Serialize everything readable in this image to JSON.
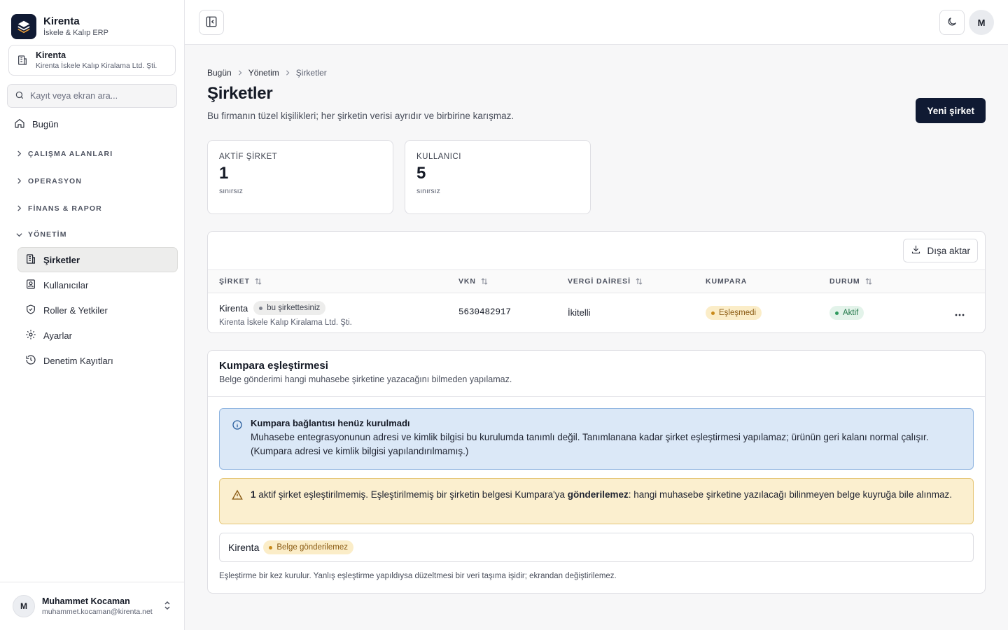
{
  "brand": {
    "name": "Kirenta",
    "subtitle": "İskele & Kalıp ERP"
  },
  "org": {
    "name": "Kirenta",
    "legal_name": "Kirenta İskele Kalıp Kiralama Ltd. Şti."
  },
  "search": {
    "placeholder": "Kayıt veya ekran ara..."
  },
  "nav": {
    "home": "Bugün",
    "groups": [
      {
        "label": "ÇALIŞMA ALANLARI"
      },
      {
        "label": "OPERASYON"
      },
      {
        "label": "FİNANS & RAPOR"
      },
      {
        "label": "YÖNETİM"
      }
    ],
    "items": [
      {
        "label": "Şirketler",
        "icon": "building-icon"
      },
      {
        "label": "Kullanıcılar",
        "icon": "user-badge-icon"
      },
      {
        "label": "Roller & Yetkiler",
        "icon": "shield-check-icon"
      },
      {
        "label": "Ayarlar",
        "icon": "gear-icon"
      },
      {
        "label": "Denetim Kayıtları",
        "icon": "history-icon"
      }
    ]
  },
  "user": {
    "initial": "M",
    "name": "Muhammet Kocaman",
    "email": "muhammet.kocaman@kirenta.net"
  },
  "topbar": {
    "avatar_initial": "M"
  },
  "breadcrumb": {
    "items": [
      "Bugün",
      "Yönetim",
      "Şirketler"
    ]
  },
  "page": {
    "title": "Şirketler",
    "description": "Bu firmanın tüzel kişilikleri; her şirketin verisi ayrıdır ve birbirine karışmaz.",
    "new_button": "Yeni şirket"
  },
  "stats": [
    {
      "label": "AKTİF ŞİRKET",
      "value": "1",
      "hint": "sınırsız"
    },
    {
      "label": "KULLANICI",
      "value": "5",
      "hint": "sınırsız"
    }
  ],
  "table": {
    "export_label": "Dışa aktar",
    "columns": [
      "ŞİRKET",
      "VKN",
      "VERGİ DAİRESİ",
      "KUMPARA",
      "DURUM"
    ],
    "rows": [
      {
        "name": "Kirenta",
        "tag": "bu şirkettesiniz",
        "legal_name": "Kirenta İskele Kalıp Kiralama Ltd. Şti.",
        "vkn": "5630482917",
        "tax_office": "İkitelli",
        "kumpara": "Eşleşmedi",
        "status": "Aktif"
      }
    ]
  },
  "kumpara": {
    "title": "Kumpara eşleştirmesi",
    "subtitle": "Belge gönderimi hangi muhasebe şirketine yazacağını bilmeden yapılamaz.",
    "info_title": "Kumpara bağlantısı henüz kurulmadı",
    "info_body": "Muhasebe entegrasyonunun adresi ve kimlik bilgisi bu kurulumda tanımlı değil. Tanımlanana kadar şirket eşleştirmesi yapılamaz; ürünün geri kalanı normal çalışır. (Kumpara adresi ve kimlik bilgisi yapılandırılmamış.)",
    "warn_count": "1",
    "warn_text_1": " aktif şirket eşleştirilmemiş. Eşleştirilmemiş bir şirketin belgesi Kumpara'ya ",
    "warn_bold": "gönderilemez",
    "warn_text_2": ": hangi muhasebe şirketine yazılacağı bilinmeyen belge kuyruğa bile alınmaz.",
    "row_name": "Kirenta",
    "row_badge": "Belge gönderilemez",
    "footnote": "Eşleştirme bir kez kurulur. Yanlış eşleştirme yapıldıysa düzeltmesi bir veri taşıma işidir; ekrandan değiştirilemez."
  },
  "colors": {
    "brand_dark": "#101a33",
    "info_bg": "#dbe8f7",
    "warn_bg": "#fbefcf",
    "success": "#2f9a5e",
    "amber": "#c98a1a"
  }
}
